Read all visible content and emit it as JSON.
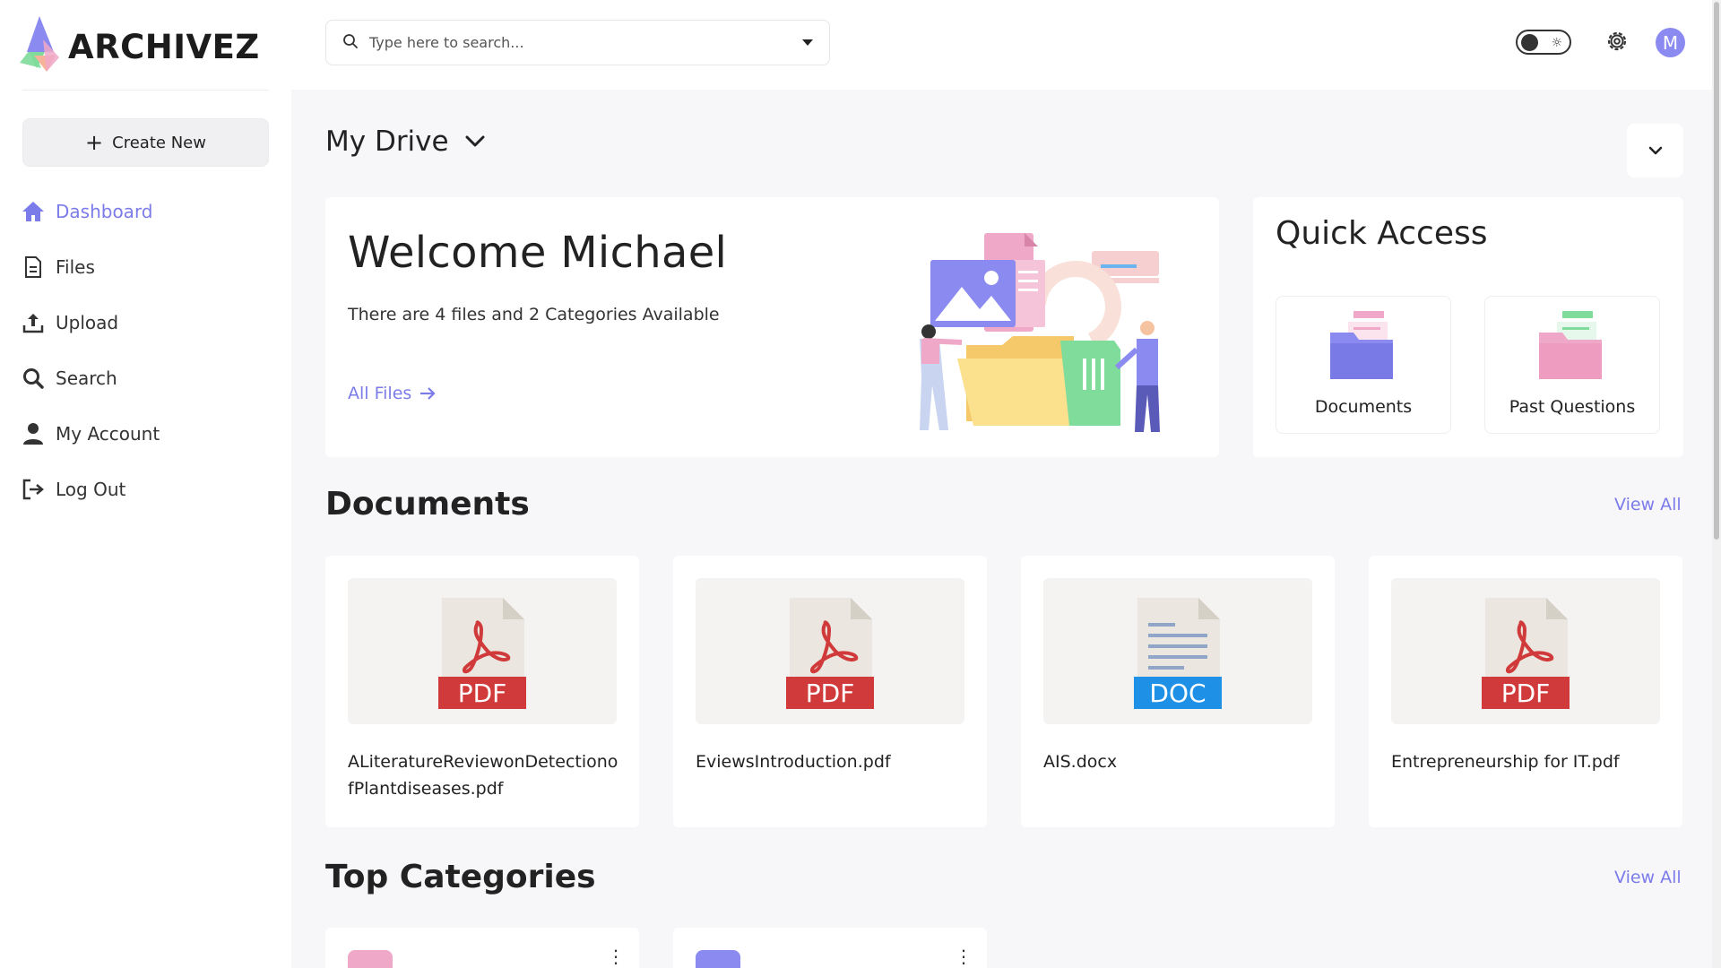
{
  "app": {
    "name": "ARCHIVEZ"
  },
  "sidebar": {
    "create_label": "Create New",
    "items": [
      {
        "label": "Dashboard",
        "icon": "home-icon",
        "active": true
      },
      {
        "label": "Files",
        "icon": "file-icon"
      },
      {
        "label": "Upload",
        "icon": "upload-icon"
      },
      {
        "label": "Search",
        "icon": "search-icon"
      },
      {
        "label": "My Account",
        "icon": "user-icon"
      },
      {
        "label": "Log Out",
        "icon": "logout-icon"
      }
    ]
  },
  "topbar": {
    "search_placeholder": "Type here to search...",
    "avatar_initial": "M",
    "theme_icon": "sun-icon"
  },
  "main": {
    "drive_title": "My Drive",
    "welcome": {
      "title": "Welcome Michael",
      "subtitle": "There are 4 files and 2 Categories Available",
      "link": "All Files"
    },
    "quick_access": {
      "title": "Quick Access",
      "items": [
        {
          "label": "Documents",
          "color": "#8a8af0",
          "tab_color": "#f0a8c8"
        },
        {
          "label": "Past Questions",
          "color": "#f0a8c8",
          "tab_color": "#7fdc9a"
        }
      ]
    },
    "documents": {
      "title": "Documents",
      "view_all": "View All",
      "files": [
        {
          "name": "ALiteratureReviewonDetectionofPlantdiseases.pdf",
          "type": "PDF"
        },
        {
          "name": "EviewsIntroduction.pdf",
          "type": "PDF"
        },
        {
          "name": "AIS.docx",
          "type": "DOC"
        },
        {
          "name": "Entrepreneurship for IT.pdf",
          "type": "PDF"
        }
      ]
    },
    "categories": {
      "title": "Top Categories",
      "view_all": "View All",
      "items": [
        {
          "color": "#f0a8c8"
        },
        {
          "color": "#8a8af0"
        }
      ]
    }
  },
  "colors": {
    "accent": "#7b7bea",
    "pdf_red": "#d03a3a",
    "doc_blue": "#1e90e6"
  }
}
